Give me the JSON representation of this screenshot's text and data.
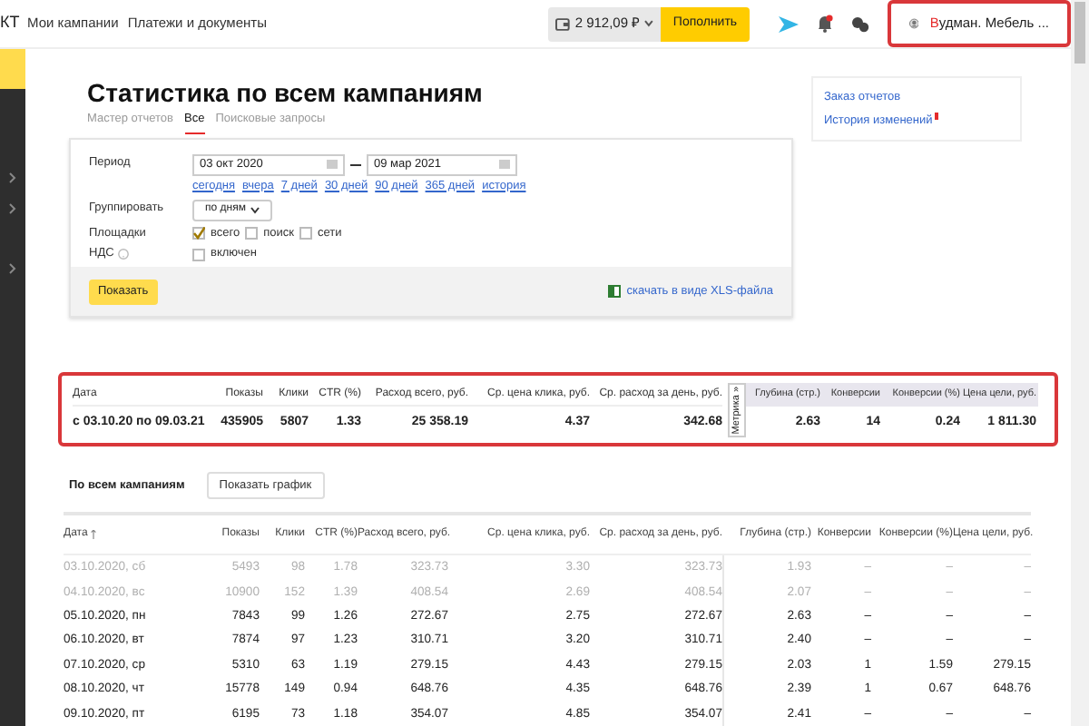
{
  "header": {
    "logo": "КТ",
    "nav": [
      {
        "label": "Мои кампании"
      },
      {
        "label": "Платежи и документы"
      }
    ],
    "balance": "2 912,09 ₽",
    "topup_button": "Пополнить",
    "account": {
      "name": "Вудман. Мебель ...",
      "highlighted": true
    }
  },
  "title": "Статистика по всем кампаниям",
  "tabs": [
    {
      "label": "Мастер отчетов",
      "selected": false
    },
    {
      "label": "Все",
      "selected": true
    },
    {
      "label": "Поисковые запросы",
      "selected": false
    }
  ],
  "filters": {
    "period_label": "Период",
    "date_from": "03 окт 2020",
    "date_to": "09 мар 2021",
    "quick_links": [
      "сегодня",
      "вчера",
      "7 дней",
      "30 дней",
      "90 дней",
      "365 дней",
      "история"
    ],
    "group_label": "Группировать",
    "group_value": "по дням",
    "platforms_label": "Площадки",
    "platforms": [
      {
        "label": "всего",
        "checked": true
      },
      {
        "label": "поиск",
        "checked": false
      },
      {
        "label": "сети",
        "checked": false
      }
    ],
    "vat_label": "НДС",
    "vat": {
      "label": "включен",
      "checked": false
    },
    "show_button": "Показать",
    "download_link": "скачать в виде XLS-файла"
  },
  "side_links": [
    {
      "label": "Заказ отчетов",
      "badge": false
    },
    {
      "label": "История изменений",
      "badge": true
    }
  ],
  "summary": {
    "highlighted": true,
    "columns": [
      "Дата",
      "Показы",
      "Клики",
      "CTR (%)",
      "Расход всего, руб.",
      "Ср. цена клика, руб.",
      "Ср. расход за день, руб."
    ],
    "metrika_label": "Метрика »",
    "metrika_columns": [
      "Глубина (стр.)",
      "Конверсии",
      "Конверсии (%)",
      "Цена цели, руб."
    ],
    "values": [
      "с 03.10.20 по 09.03.21",
      "435905",
      "5807",
      "1.33",
      "25 358.19",
      "4.37",
      "342.68"
    ],
    "metrika_values": [
      "2.63",
      "14",
      "0.24",
      "1 811.30"
    ]
  },
  "section_title": "По всем кампаниям",
  "chart_button": "Показать график",
  "table": {
    "columns": [
      "Дата",
      "Показы",
      "Клики",
      "CTR (%)",
      "Расход всего, руб.",
      "Ср. цена клика, руб.",
      "Ср. расход за день, руб.",
      "Глубина (стр.)",
      "Конверсии",
      "Конверсии (%)",
      "Цена цели, руб."
    ],
    "rows": [
      {
        "dimmed": true,
        "cells": [
          "03.10.2020, сб",
          "5493",
          "98",
          "1.78",
          "323.73",
          "3.30",
          "323.73",
          "1.93",
          "–",
          "–",
          "–"
        ]
      },
      {
        "dimmed": true,
        "cells": [
          "04.10.2020, вс",
          "10900",
          "152",
          "1.39",
          "408.54",
          "2.69",
          "408.54",
          "2.07",
          "–",
          "–",
          "–"
        ]
      },
      {
        "dimmed": false,
        "cells": [
          "05.10.2020, пн",
          "7843",
          "99",
          "1.26",
          "272.67",
          "2.75",
          "272.67",
          "2.63",
          "–",
          "–",
          "–"
        ]
      },
      {
        "dimmed": false,
        "cells": [
          "06.10.2020, вт",
          "7874",
          "97",
          "1.23",
          "310.71",
          "3.20",
          "310.71",
          "2.40",
          "–",
          "–",
          "–"
        ]
      },
      {
        "dimmed": false,
        "cells": [
          "07.10.2020, ср",
          "5310",
          "63",
          "1.19",
          "279.15",
          "4.43",
          "279.15",
          "2.03",
          "1",
          "1.59",
          "279.15"
        ]
      },
      {
        "dimmed": false,
        "cells": [
          "08.10.2020, чт",
          "15778",
          "149",
          "0.94",
          "648.76",
          "4.35",
          "648.76",
          "2.39",
          "1",
          "0.67",
          "648.76"
        ]
      },
      {
        "dimmed": false,
        "cells": [
          "09.10.2020, пт",
          "6195",
          "73",
          "1.18",
          "354.07",
          "4.85",
          "354.07",
          "2.41",
          "–",
          "–",
          "–"
        ]
      }
    ]
  }
}
